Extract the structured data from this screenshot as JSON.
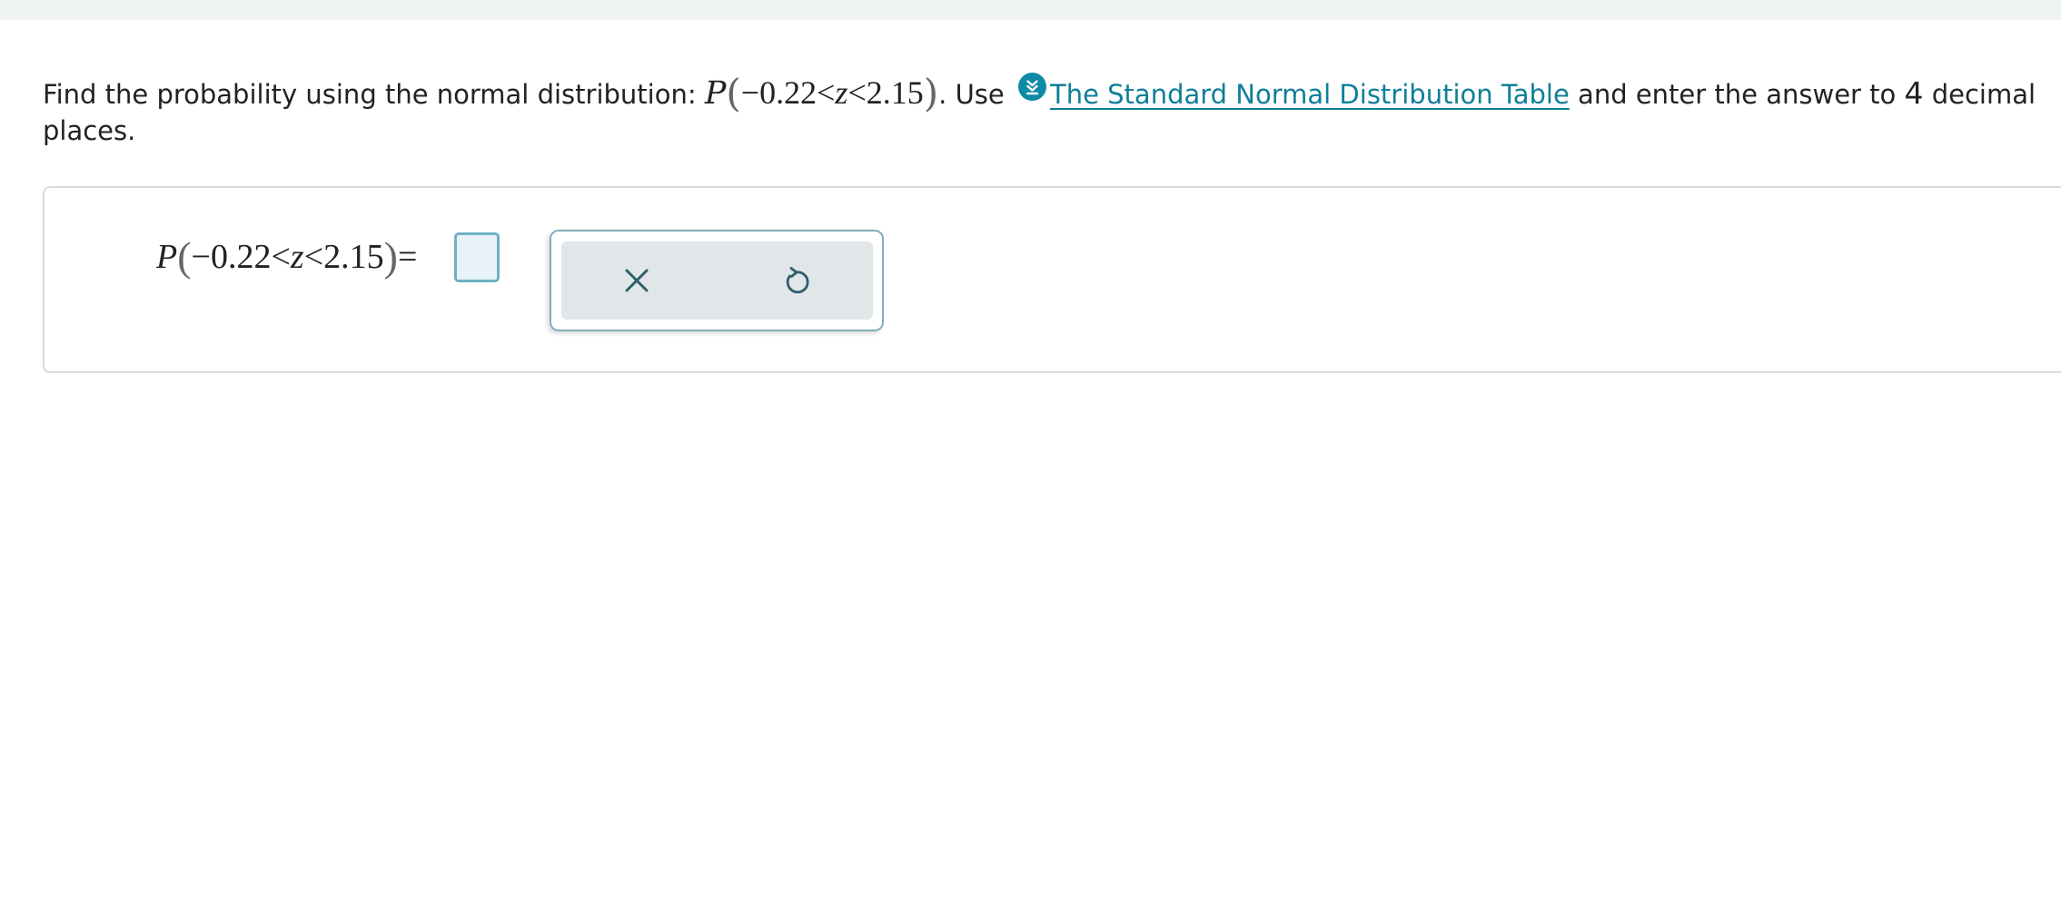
{
  "question": {
    "prefix": "Find the probability using the normal distribution: ",
    "prob_symbol": "P",
    "lower": "−0.22",
    "lt1": "<",
    "variable": "z",
    "lt2": "<",
    "upper": "2.15",
    "after_math": ". Use ",
    "link_text": "The Standard Normal Distribution Table",
    "mid_text": " and enter the answer to ",
    "decimals": "4",
    "suffix": " decimal places."
  },
  "answer": {
    "prob_symbol": "P",
    "lower": "−0.22",
    "lt1": "<",
    "variable": "z",
    "lt2": "<",
    "upper": "2.15",
    "equals": "=",
    "value": ""
  },
  "tools": {
    "clear_icon": "close-icon",
    "undo_icon": "undo-icon"
  },
  "colors": {
    "accent": "#0d8ba5",
    "link": "#0d7f99",
    "input_border": "#6fb0c3",
    "toolbar_bg": "#e1e7e9"
  }
}
